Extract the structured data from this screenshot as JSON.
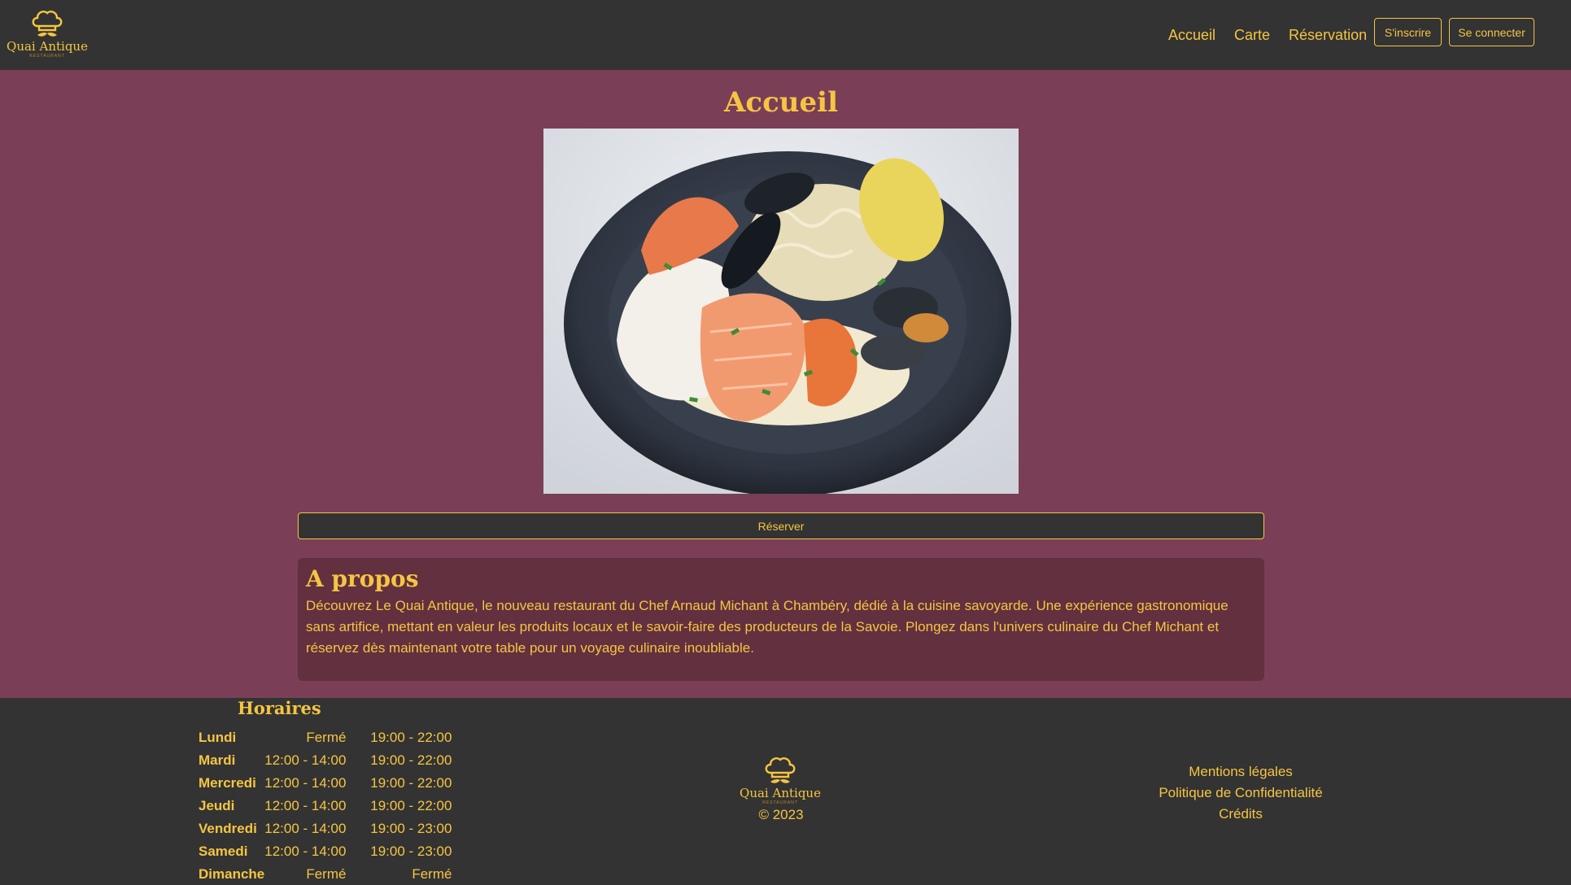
{
  "colors": {
    "accent": "#f5c542",
    "background": "#7a3f57",
    "header_footer": "#333333",
    "about_panel": "#62303f"
  },
  "brand": {
    "name": "Quai Antique",
    "subtitle": "RESTAURANT",
    "icon": "chef-hat-mustache-icon"
  },
  "nav": {
    "links": [
      "Accueil",
      "Carte",
      "Réservation"
    ],
    "signup_label": "S'inscrire",
    "login_label": "Se connecter"
  },
  "main": {
    "title": "Accueil",
    "hero_alt": "Assiette de poissons et fruits de mer sur choucroute",
    "reserve_label": "Réserver",
    "about": {
      "title": "A propos",
      "text": "Découvrez Le Quai Antique, le nouveau restaurant du Chef Arnaud Michant à Chambéry, dédié à la cuisine savoyarde. Une expérience gastronomique sans artifice, mettant en valeur les produits locaux et le savoir-faire des producteurs de la Savoie. Plongez dans l'univers culinaire du Chef Michant et réservez dès maintenant votre table pour un voyage culinaire inoubliable."
    }
  },
  "footer": {
    "hours_title": "Horaires",
    "hours": [
      {
        "day": "Lundi",
        "am": "Fermé",
        "pm": "19:00 - 22:00"
      },
      {
        "day": "Mardi",
        "am": "12:00 - 14:00",
        "pm": "19:00 - 22:00"
      },
      {
        "day": "Mercredi",
        "am": "12:00 - 14:00",
        "pm": "19:00 - 22:00"
      },
      {
        "day": "Jeudi",
        "am": "12:00 - 14:00",
        "pm": "19:00 - 22:00"
      },
      {
        "day": "Vendredi",
        "am": "12:00 - 14:00",
        "pm": "19:00 - 23:00"
      },
      {
        "day": "Samedi",
        "am": "12:00 - 14:00",
        "pm": "19:00 - 23:00"
      },
      {
        "day": "Dimanche",
        "am": "Fermé",
        "pm": "Fermé"
      }
    ],
    "copyright": "© 2023",
    "legal_links": [
      "Mentions légales",
      "Politique de Confidentialité",
      "Crédits"
    ]
  }
}
